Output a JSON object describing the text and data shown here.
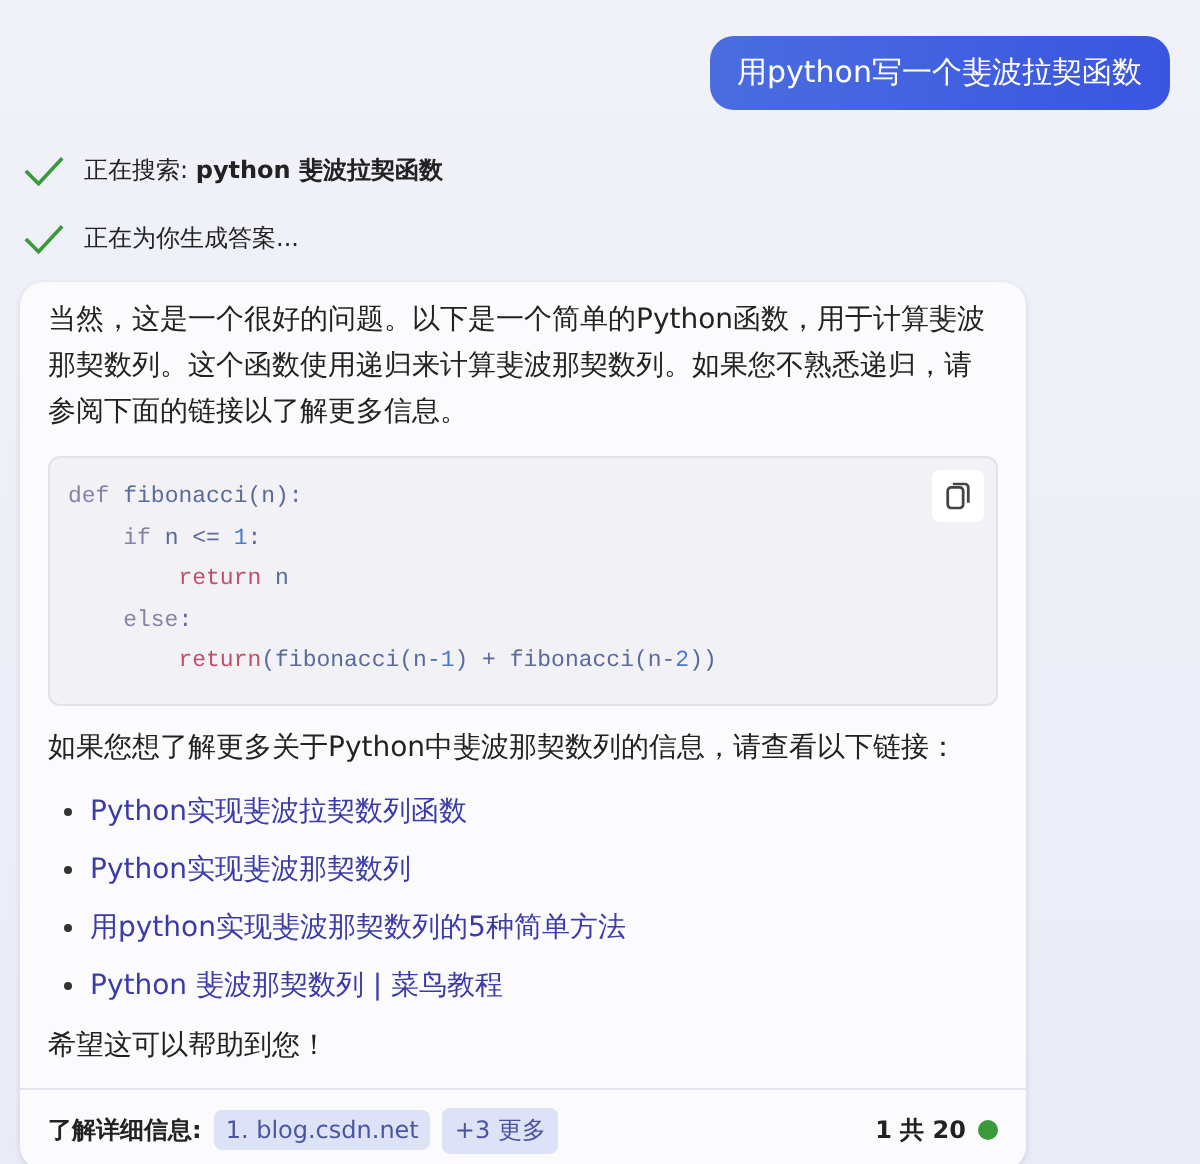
{
  "user_message": "用python写一个斐波拉契函数",
  "progress": [
    {
      "label": "正在搜索: ",
      "detail": "python 斐波拉契函数",
      "done": true
    },
    {
      "label": "正在为你生成答案...",
      "done": true
    }
  ],
  "answer": {
    "intro": "当然，这是一个很好的问题。以下是一个简单的Python函数，用于计算斐波那契数列。这个函数使用递归来计算斐波那契数列。如果您不熟悉递归，请参阅下面的链接以了解更多信息。",
    "code": [
      [
        {
          "t": "def",
          "kind": "keyword"
        },
        {
          "t": " fibonacci(n):",
          "kind": "plain"
        }
      ],
      [
        {
          "t": "    if",
          "kind": "keyword"
        },
        {
          "t": " n <= ",
          "kind": "plain"
        },
        {
          "t": "1",
          "kind": "number"
        },
        {
          "t": ":",
          "kind": "plain"
        }
      ],
      [
        {
          "t": "        return",
          "kind": "return"
        },
        {
          "t": " n",
          "kind": "plain"
        }
      ],
      [
        {
          "t": "    else",
          "kind": "keyword"
        },
        {
          "t": ":",
          "kind": "plain"
        }
      ],
      [
        {
          "t": "        return",
          "kind": "return"
        },
        {
          "t": "(fibonacci(n-",
          "kind": "plain"
        },
        {
          "t": "1",
          "kind": "number"
        },
        {
          "t": ") + fibonacci(n-",
          "kind": "plain"
        },
        {
          "t": "2",
          "kind": "number"
        },
        {
          "t": "))",
          "kind": "plain"
        }
      ]
    ],
    "links_intro": "如果您想了解更多关于Python中斐波那契数列的信息，请查看以下链接：",
    "links": [
      "Python实现斐波拉契数列函数",
      "Python实现斐波那契数列",
      "用python实现斐波那契数列的5种简单方法",
      "Python 斐波那契数列 | 菜鸟教程"
    ],
    "closing": "希望这可以帮助到您！",
    "footer": {
      "label": "了解详细信息:",
      "sources": [
        "1. blog.csdn.net",
        "+3 更多"
      ],
      "turn_counter": "1 共 20"
    }
  }
}
